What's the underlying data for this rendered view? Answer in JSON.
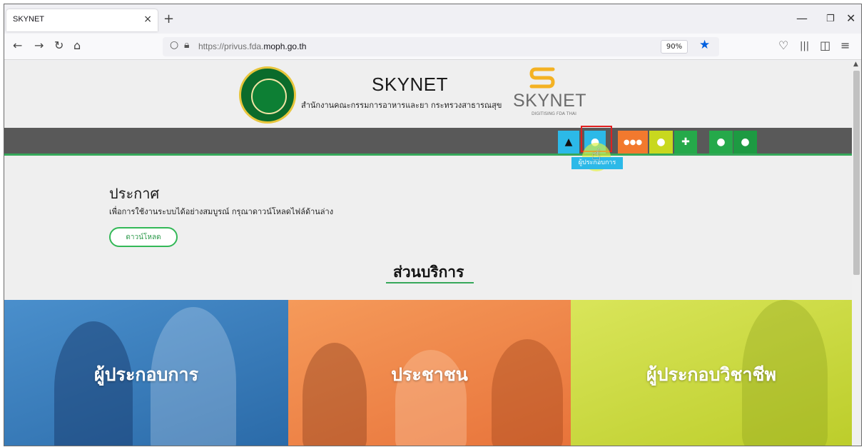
{
  "browser": {
    "tab_title": "SKYNET",
    "tab_close": "×",
    "new_tab": "+",
    "url_prefix": "https://privus.fda.",
    "url_domain": "moph.go.th",
    "zoom": "90%"
  },
  "header": {
    "title": "SKYNET",
    "subtitle": "สำนักงานคณะกรรมการอาหารและยา กระทรวงสาธารณสุข",
    "brand_word": "SKYNET",
    "brand_tagline": "DIGITISING FDA THAI"
  },
  "menu": {
    "buttons": [
      {
        "name": "home",
        "color": "#2cb9e8",
        "glyph": "▲"
      },
      {
        "name": "entrepreneur",
        "color": "#2cb9e8",
        "glyph": "●"
      },
      {
        "name": "public",
        "color": "#f2792e",
        "glyph": "●●●"
      },
      {
        "name": "professional",
        "color": "#c8d81f",
        "glyph": "●"
      },
      {
        "name": "medical",
        "color": "#25a94a",
        "glyph": "✚"
      },
      {
        "name": "officer",
        "color": "#25a94a",
        "glyph": "●"
      },
      {
        "name": "staff",
        "color": "#1d9a42",
        "glyph": "●"
      }
    ],
    "tooltip": "ผู้ประกอบการ"
  },
  "announcement": {
    "title": "ประกาศ",
    "description": "เพื่อการใช้งานระบบได้อย่างสมบูรณ์ กรุณาดาวน์โหลดไฟล์ด้านล่าง",
    "download_label": "ดาวน์โหลด"
  },
  "services": {
    "title": "ส่วนบริการ",
    "cards": [
      {
        "label": "ผู้ประกอบการ",
        "color": "#2e7cc0"
      },
      {
        "label": "ประชาชน",
        "color": "#f08a4b"
      },
      {
        "label": "ผู้ประกอบวิชาชีพ",
        "color": "#c9d839"
      }
    ]
  }
}
